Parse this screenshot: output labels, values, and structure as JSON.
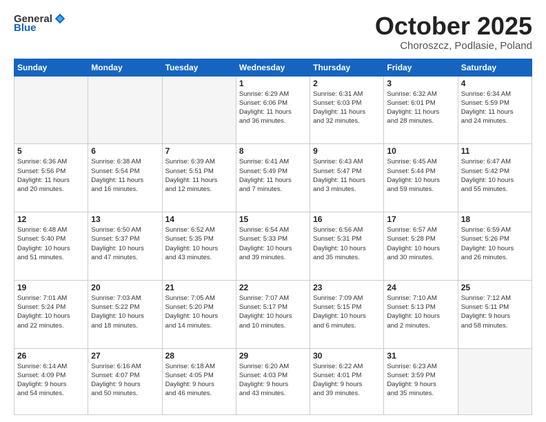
{
  "header": {
    "logo_general": "General",
    "logo_blue": "Blue",
    "month": "October 2025",
    "location": "Choroszcz, Podlasie, Poland"
  },
  "days_of_week": [
    "Sunday",
    "Monday",
    "Tuesday",
    "Wednesday",
    "Thursday",
    "Friday",
    "Saturday"
  ],
  "weeks": [
    [
      {
        "day": "",
        "info": ""
      },
      {
        "day": "",
        "info": ""
      },
      {
        "day": "",
        "info": ""
      },
      {
        "day": "1",
        "info": "Sunrise: 6:29 AM\nSunset: 6:06 PM\nDaylight: 11 hours\nand 36 minutes."
      },
      {
        "day": "2",
        "info": "Sunrise: 6:31 AM\nSunset: 6:03 PM\nDaylight: 11 hours\nand 32 minutes."
      },
      {
        "day": "3",
        "info": "Sunrise: 6:32 AM\nSunset: 6:01 PM\nDaylight: 11 hours\nand 28 minutes."
      },
      {
        "day": "4",
        "info": "Sunrise: 6:34 AM\nSunset: 5:59 PM\nDaylight: 11 hours\nand 24 minutes."
      }
    ],
    [
      {
        "day": "5",
        "info": "Sunrise: 6:36 AM\nSunset: 5:56 PM\nDaylight: 11 hours\nand 20 minutes."
      },
      {
        "day": "6",
        "info": "Sunrise: 6:38 AM\nSunset: 5:54 PM\nDaylight: 11 hours\nand 16 minutes."
      },
      {
        "day": "7",
        "info": "Sunrise: 6:39 AM\nSunset: 5:51 PM\nDaylight: 11 hours\nand 12 minutes."
      },
      {
        "day": "8",
        "info": "Sunrise: 6:41 AM\nSunset: 5:49 PM\nDaylight: 11 hours\nand 7 minutes."
      },
      {
        "day": "9",
        "info": "Sunrise: 6:43 AM\nSunset: 5:47 PM\nDaylight: 11 hours\nand 3 minutes."
      },
      {
        "day": "10",
        "info": "Sunrise: 6:45 AM\nSunset: 5:44 PM\nDaylight: 10 hours\nand 59 minutes."
      },
      {
        "day": "11",
        "info": "Sunrise: 6:47 AM\nSunset: 5:42 PM\nDaylight: 10 hours\nand 55 minutes."
      }
    ],
    [
      {
        "day": "12",
        "info": "Sunrise: 6:48 AM\nSunset: 5:40 PM\nDaylight: 10 hours\nand 51 minutes."
      },
      {
        "day": "13",
        "info": "Sunrise: 6:50 AM\nSunset: 5:37 PM\nDaylight: 10 hours\nand 47 minutes."
      },
      {
        "day": "14",
        "info": "Sunrise: 6:52 AM\nSunset: 5:35 PM\nDaylight: 10 hours\nand 43 minutes."
      },
      {
        "day": "15",
        "info": "Sunrise: 6:54 AM\nSunset: 5:33 PM\nDaylight: 10 hours\nand 39 minutes."
      },
      {
        "day": "16",
        "info": "Sunrise: 6:56 AM\nSunset: 5:31 PM\nDaylight: 10 hours\nand 35 minutes."
      },
      {
        "day": "17",
        "info": "Sunrise: 6:57 AM\nSunset: 5:28 PM\nDaylight: 10 hours\nand 30 minutes."
      },
      {
        "day": "18",
        "info": "Sunrise: 6:59 AM\nSunset: 5:26 PM\nDaylight: 10 hours\nand 26 minutes."
      }
    ],
    [
      {
        "day": "19",
        "info": "Sunrise: 7:01 AM\nSunset: 5:24 PM\nDaylight: 10 hours\nand 22 minutes."
      },
      {
        "day": "20",
        "info": "Sunrise: 7:03 AM\nSunset: 5:22 PM\nDaylight: 10 hours\nand 18 minutes."
      },
      {
        "day": "21",
        "info": "Sunrise: 7:05 AM\nSunset: 5:20 PM\nDaylight: 10 hours\nand 14 minutes."
      },
      {
        "day": "22",
        "info": "Sunrise: 7:07 AM\nSunset: 5:17 PM\nDaylight: 10 hours\nand 10 minutes."
      },
      {
        "day": "23",
        "info": "Sunrise: 7:09 AM\nSunset: 5:15 PM\nDaylight: 10 hours\nand 6 minutes."
      },
      {
        "day": "24",
        "info": "Sunrise: 7:10 AM\nSunset: 5:13 PM\nDaylight: 10 hours\nand 2 minutes."
      },
      {
        "day": "25",
        "info": "Sunrise: 7:12 AM\nSunset: 5:11 PM\nDaylight: 9 hours\nand 58 minutes."
      }
    ],
    [
      {
        "day": "26",
        "info": "Sunrise: 6:14 AM\nSunset: 4:09 PM\nDaylight: 9 hours\nand 54 minutes."
      },
      {
        "day": "27",
        "info": "Sunrise: 6:16 AM\nSunset: 4:07 PM\nDaylight: 9 hours\nand 50 minutes."
      },
      {
        "day": "28",
        "info": "Sunrise: 6:18 AM\nSunset: 4:05 PM\nDaylight: 9 hours\nand 46 minutes."
      },
      {
        "day": "29",
        "info": "Sunrise: 6:20 AM\nSunset: 4:03 PM\nDaylight: 9 hours\nand 43 minutes."
      },
      {
        "day": "30",
        "info": "Sunrise: 6:22 AM\nSunset: 4:01 PM\nDaylight: 9 hours\nand 39 minutes."
      },
      {
        "day": "31",
        "info": "Sunrise: 6:23 AM\nSunset: 3:59 PM\nDaylight: 9 hours\nand 35 minutes."
      },
      {
        "day": "",
        "info": ""
      }
    ]
  ]
}
